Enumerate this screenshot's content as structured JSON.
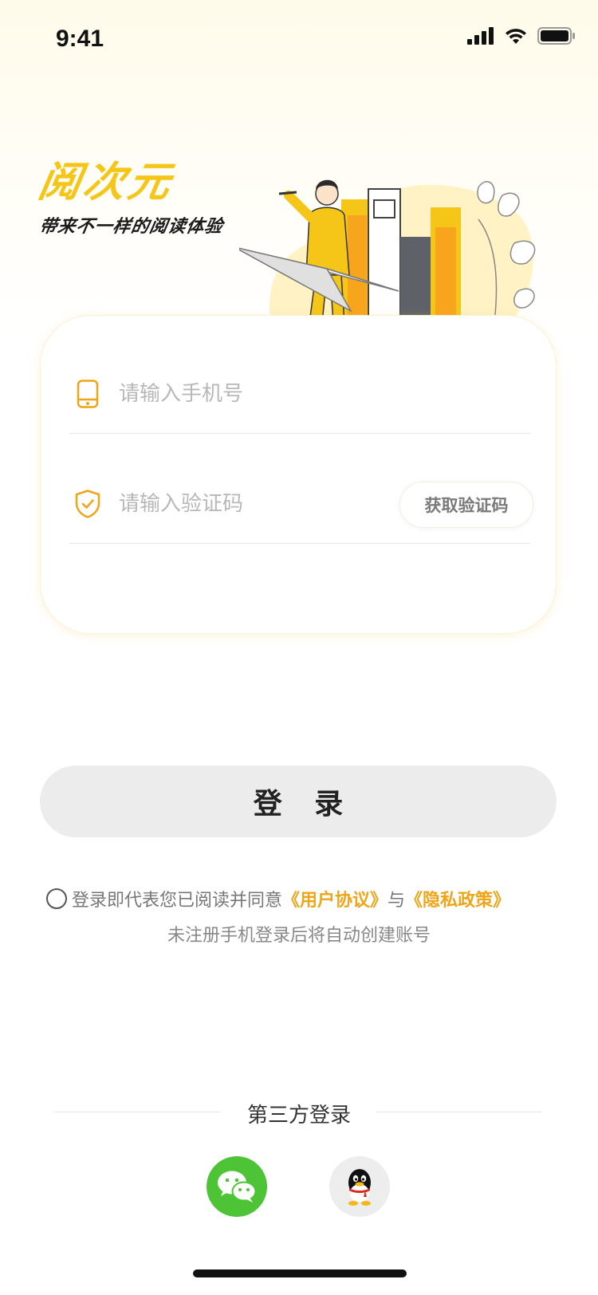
{
  "status_bar": {
    "time": "9:41"
  },
  "brand": {
    "title": "阅次元",
    "slogan": "带来不一样的阅读体验"
  },
  "form": {
    "phone_placeholder": "请输入手机号",
    "code_placeholder": "请输入验证码",
    "get_code_label": "获取验证码"
  },
  "login_button_label": "登 录",
  "agreement": {
    "prefix": "登录即代表您已阅读并同意",
    "user_agreement": "《用户协议》",
    "conjunction": "与",
    "privacy_policy": "《隐私政策》",
    "note": "未注册手机登录后将自动创建账号"
  },
  "third_party": {
    "label": "第三方登录"
  },
  "icons": {
    "phone": "phone-icon",
    "shield": "shield-check-icon",
    "wechat": "wechat-icon",
    "qq": "qq-icon",
    "signal": "signal-icon",
    "wifi": "wifi-icon",
    "battery": "battery-icon"
  },
  "colors": {
    "accent": "#f0a418",
    "brand_yellow": "#f5c518",
    "wechat_green": "#4cc436",
    "login_button_bg": "#ececec"
  }
}
